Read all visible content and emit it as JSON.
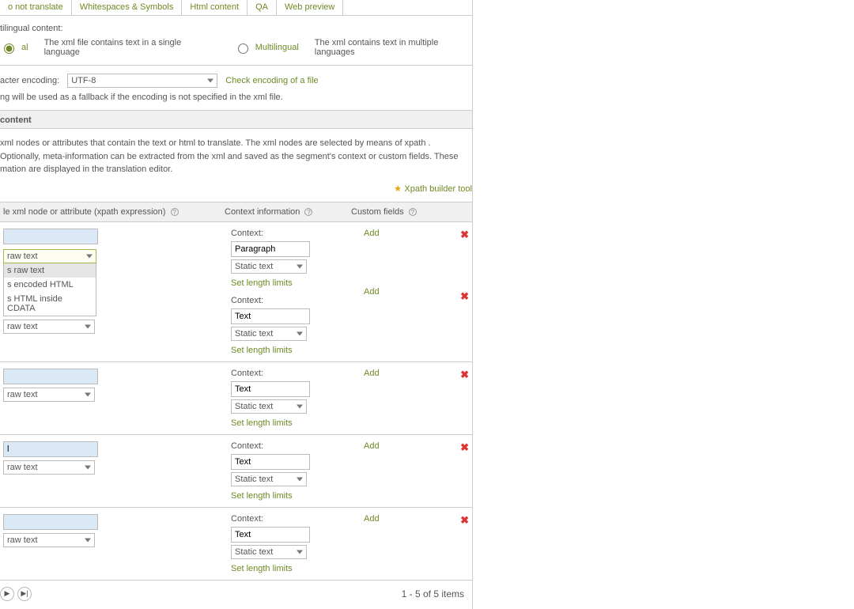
{
  "tabs": [
    "o not translate",
    "Whitespaces & Symbols",
    "Html content",
    "QA",
    "Web preview"
  ],
  "multilingual": {
    "header": "tilingual content:",
    "mono": {
      "label": "al",
      "desc": "The xml file contains text in a single language"
    },
    "multi": {
      "label": "Multilingual",
      "desc": "The xml contains text in multiple languages"
    }
  },
  "encoding": {
    "label": "acter encoding:",
    "value": "UTF-8",
    "check": "Check encoding of a file",
    "hint": "ng will be used as a fallback if the encoding is not specified in the xml file."
  },
  "contentHeader": "content",
  "contentDesc": " xml nodes or attributes that contain the text or html to translate. The xml nodes are selected by means of xpath . Optionally, meta-information can be extracted from the xml and saved as the segment's context or custom fields. These mation are displayed in the translation editor.",
  "builder": "Xpath builder tool",
  "columns": {
    "xpath": "le xml node or attribute (xpath expression)",
    "context": "Context information",
    "custom": "Custom fields"
  },
  "dd": {
    "raw": "raw text",
    "opts": [
      "s raw text",
      "s encoded HTML",
      "s HTML inside CDATA"
    ]
  },
  "ctx": {
    "label": "Context:",
    "static": "Static text",
    "limits": "Set length limits"
  },
  "custom": {
    "add": "Add"
  },
  "rows": [
    {
      "xpath": "",
      "context": "Paragraph"
    },
    {
      "xpath": "",
      "context": "Text"
    },
    {
      "xpath": "",
      "context": "Text"
    },
    {
      "xpath": "l",
      "context": "Text"
    },
    {
      "xpath": "",
      "context": "Text"
    }
  ],
  "pager": "1 - 5 of 5 items"
}
